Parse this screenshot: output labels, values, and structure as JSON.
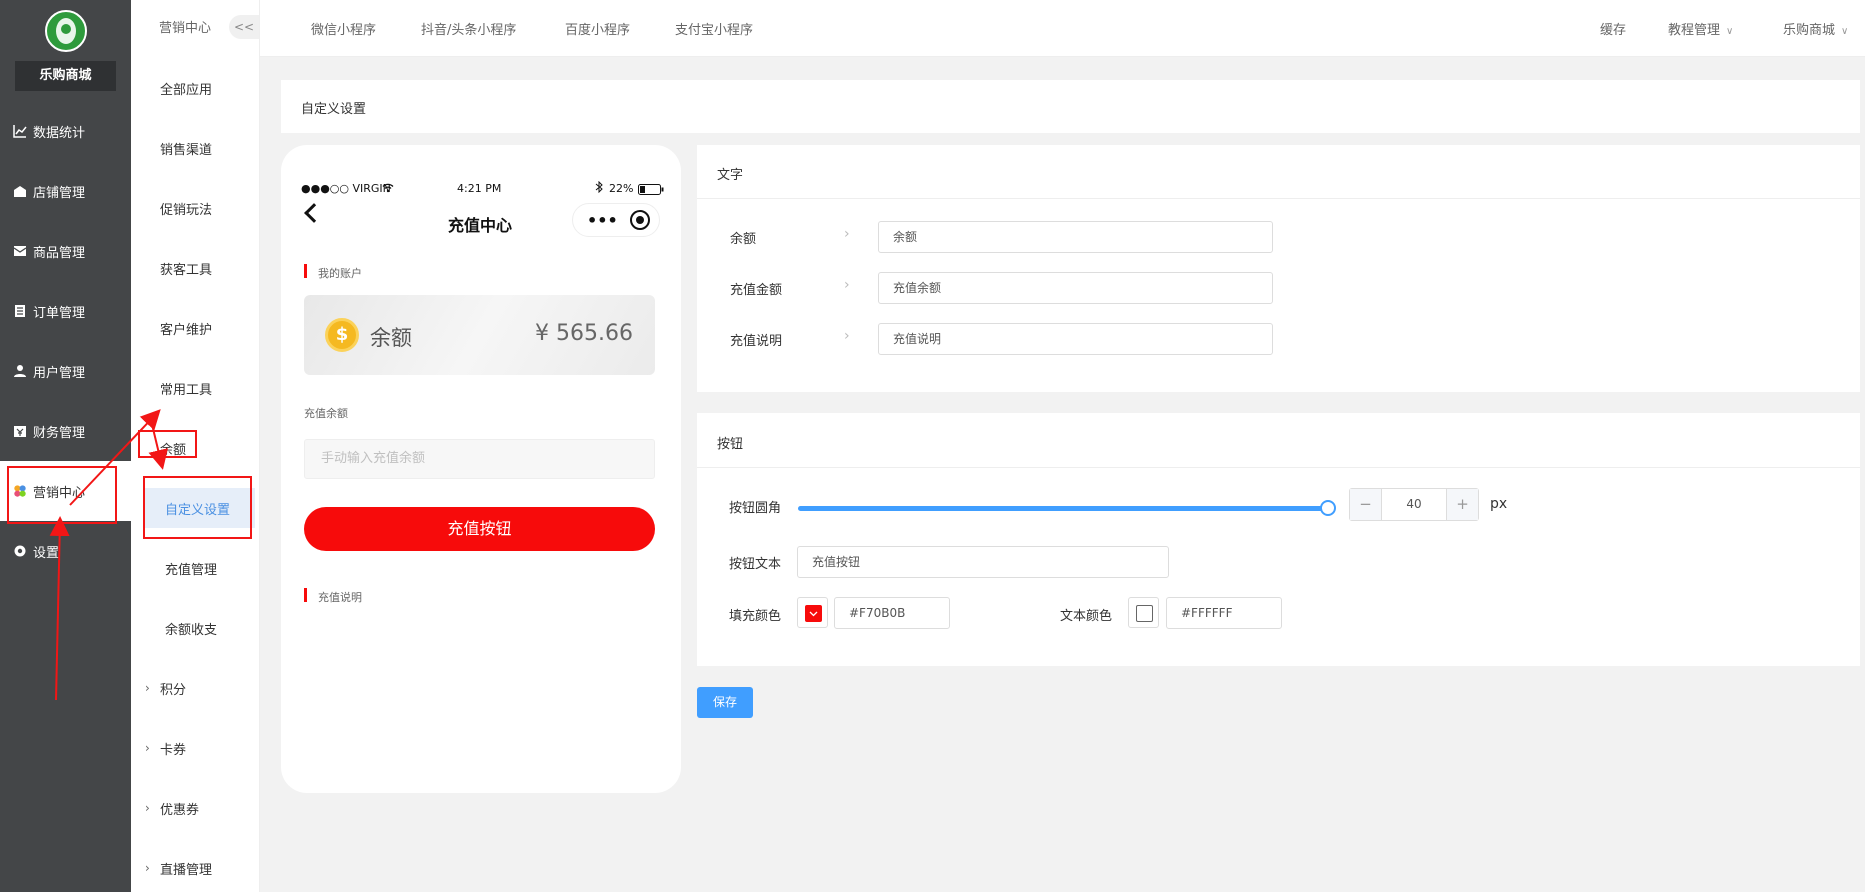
{
  "brand": {
    "shop_name": "乐购商城"
  },
  "sidebar": {
    "items": [
      {
        "label": "数据统计",
        "icon": "chart-line-icon"
      },
      {
        "label": "店铺管理",
        "icon": "shop-icon"
      },
      {
        "label": "商品管理",
        "icon": "box-icon"
      },
      {
        "label": "订单管理",
        "icon": "document-icon"
      },
      {
        "label": "用户管理",
        "icon": "user-icon"
      },
      {
        "label": "财务管理",
        "icon": "finance-icon"
      },
      {
        "label": "营销中心",
        "icon": "marketing-icon"
      },
      {
        "label": "设置",
        "icon": "gear-icon"
      }
    ]
  },
  "submenu": {
    "title": "营销中心",
    "collapse": "<<",
    "items": [
      "全部应用",
      "销售渠道",
      "促销玩法",
      "获客工具",
      "客户维护",
      "常用工具"
    ],
    "group_balance": "余额",
    "balance_children": [
      "自定义设置",
      "充值管理",
      "余额收支"
    ],
    "collapsed_groups": [
      "积分",
      "卡券",
      "优惠券",
      "直播管理"
    ]
  },
  "topbar": {
    "links": [
      "微信小程序",
      "抖音/头条小程序",
      "百度小程序",
      "支付宝小程序"
    ],
    "right": {
      "cache": "缓存",
      "tutorial": "教程管理",
      "shop": "乐购商城"
    }
  },
  "page": {
    "title": "自定义设置"
  },
  "phone": {
    "carrier": "●●●○○ VIRGIN",
    "time": "4:21 PM",
    "battery": "22%",
    "title": "充值中心",
    "more": "•••",
    "account_label": "我的账户",
    "balance_label": "余额",
    "balance_value": "¥ 565.66",
    "recharge_label": "充值余额",
    "input_placeholder": "手动输入充值余额",
    "button_text": "充值按钮",
    "desc_label": "充值说明"
  },
  "text_settings": {
    "title": "文字",
    "fields": [
      {
        "label": "余额",
        "value": "余额"
      },
      {
        "label": "充值金额",
        "value": "充值余额"
      },
      {
        "label": "充值说明",
        "value": "充值说明"
      }
    ]
  },
  "button_settings": {
    "title": "按钮",
    "radius_label": "按钮圆角",
    "radius_value": "40",
    "radius_fraction": 1.0,
    "radius_unit": "px",
    "minus": "−",
    "plus": "+",
    "text_label": "按钮文本",
    "text_value": "充值按钮",
    "fill_label": "填充颜色",
    "fill_color": "#F70B0B",
    "text_color_label": "文本颜色",
    "text_color": "#FFFFFF"
  },
  "actions": {
    "save": "保存"
  }
}
